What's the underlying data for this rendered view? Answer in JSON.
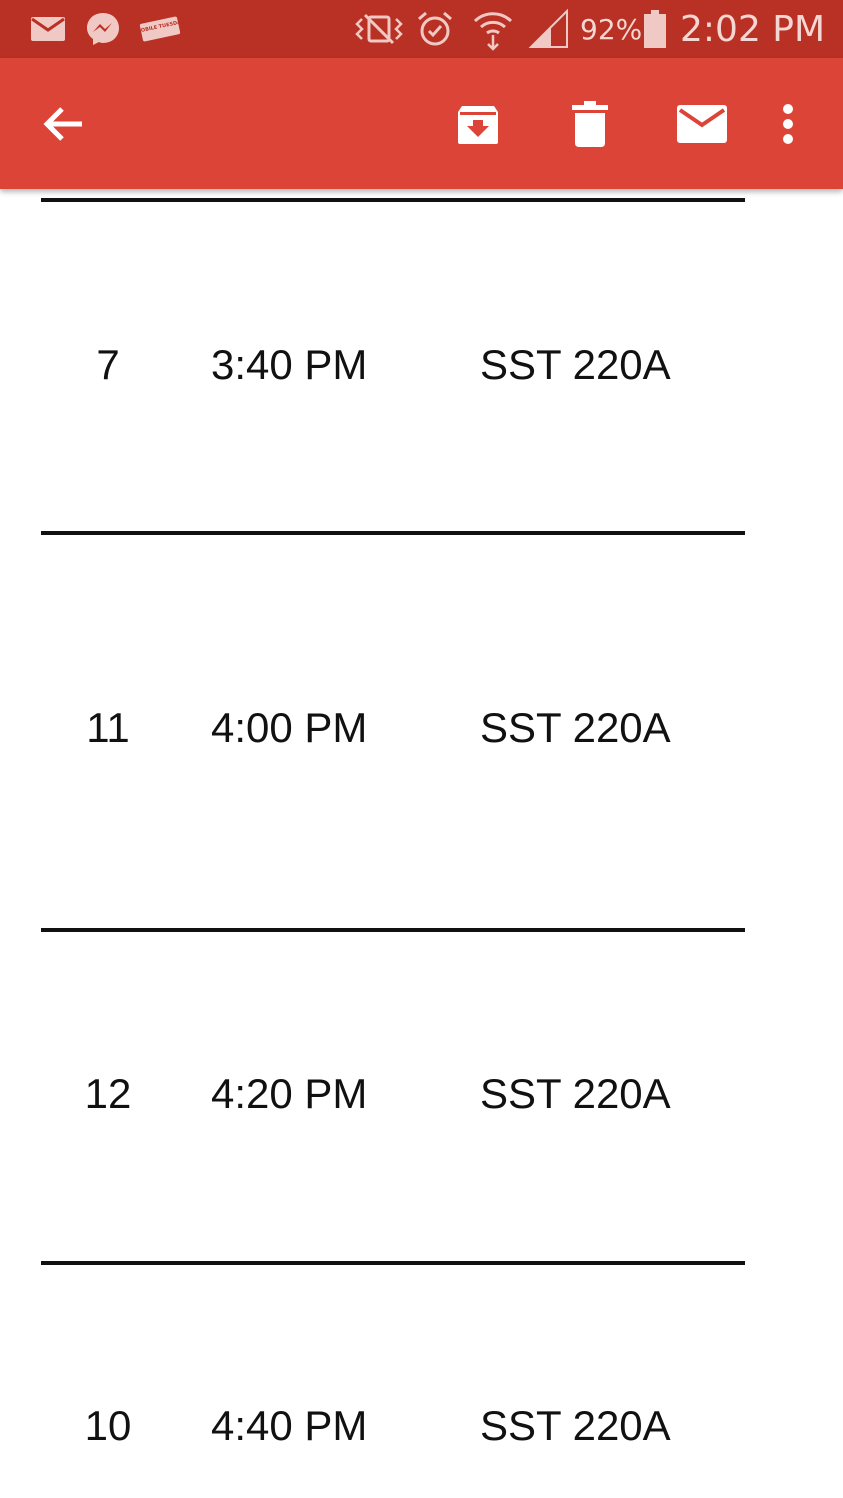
{
  "status_bar": {
    "notification_icons": [
      "gmail-icon",
      "messenger-icon",
      "tmobile-tuesdays-icon"
    ],
    "tmobile_badge_text": "T-MOBILE TUESDAYS",
    "system_icons": [
      "vibrate-icon",
      "alarm-icon",
      "wifi-icon",
      "signal-icon",
      "battery-icon"
    ],
    "battery": "92%",
    "time": "2:02 PM"
  },
  "app_bar": {
    "actions": [
      {
        "name": "back",
        "icon": "arrow-back-icon"
      },
      {
        "name": "archive",
        "icon": "archive-icon"
      },
      {
        "name": "delete",
        "icon": "trash-icon"
      },
      {
        "name": "mark-unread",
        "icon": "mail-icon"
      },
      {
        "name": "more",
        "icon": "more-vert-icon"
      }
    ]
  },
  "schedule": {
    "rows": [
      {
        "num": "7",
        "time": "3:40 PM",
        "room": "SST 220A"
      },
      {
        "num": "11",
        "time": "4:00 PM",
        "room": "SST 220A"
      },
      {
        "num": "12",
        "time": "4:20 PM",
        "room": "SST 220A"
      },
      {
        "num": "10",
        "time": "4:40 PM",
        "room": "SST 220A"
      }
    ]
  },
  "colors": {
    "status_bar": "#b93024",
    "app_bar": "#db4437",
    "icon": "#ffffff",
    "text": "#111111"
  }
}
